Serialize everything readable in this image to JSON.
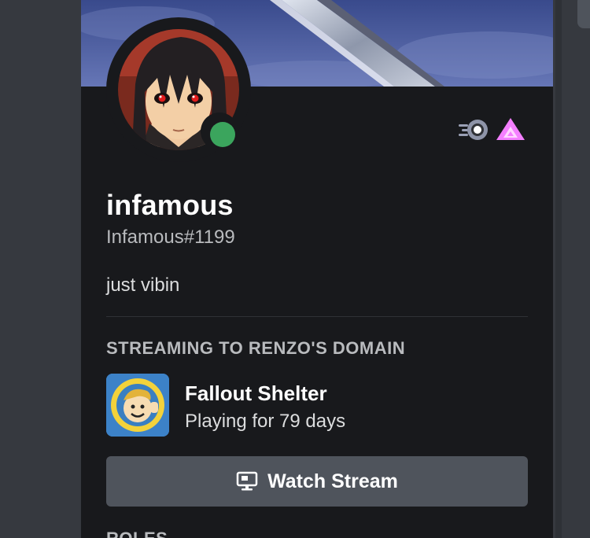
{
  "profile": {
    "display_name": "infamous",
    "tag": "Infamous#1199",
    "custom_status": "just vibin",
    "status": "online",
    "status_color": "#3ba55d",
    "badges": [
      "nitro-boost-icon",
      "hypesquad-brilliance-icon"
    ]
  },
  "activity": {
    "header": "STREAMING TO RENZO'S DOMAIN",
    "game_name": "Fallout Shelter",
    "elapsed": "Playing for 79 days",
    "watch_button_label": "Watch Stream",
    "watch_button_icon": "screen-share-icon"
  },
  "next_section": {
    "header": "ROLES"
  },
  "colors": {
    "card_bg": "#18191c",
    "app_bg": "#36393f",
    "button_bg": "#4f545c"
  }
}
